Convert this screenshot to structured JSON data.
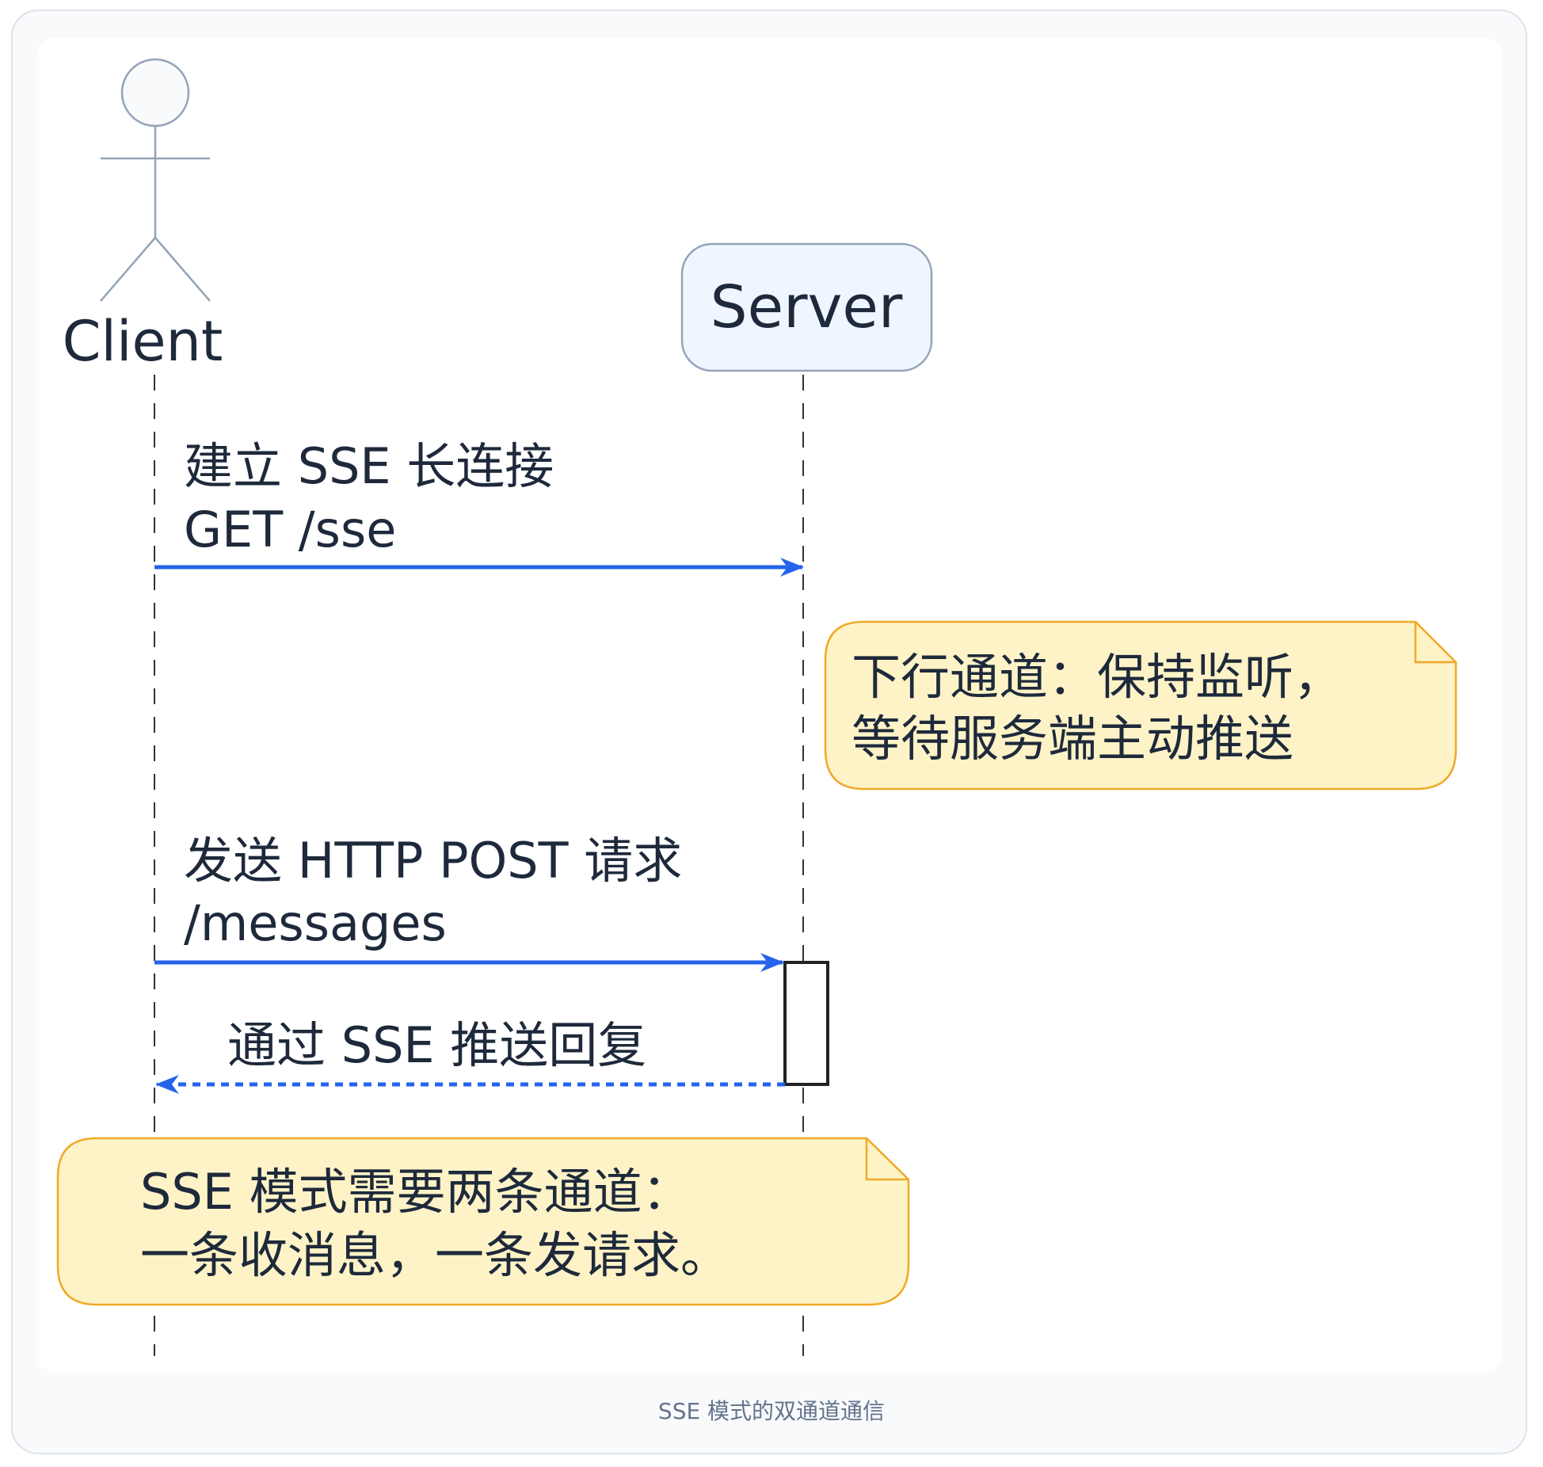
{
  "participants": {
    "client": "Client",
    "server": "Server"
  },
  "messages": [
    {
      "line1": "建立 SSE 长连接",
      "line2": "GET /sse"
    },
    {
      "line1": "发送 HTTP POST 请求",
      "line2": "/messages"
    },
    {
      "line1": "通过 SSE 推送回复"
    }
  ],
  "notes": [
    {
      "line1": "下行通道：保持监听，",
      "line2": "等待服务端主动推送"
    },
    {
      "line1": "SSE 模式需要两条通道：",
      "line2": "一条收消息，一条发请求。"
    }
  ],
  "caption": "SSE 模式的双通道通信",
  "colors": {
    "arrow": "#2563eb",
    "note_fill": "#fef3c7",
    "note_stroke": "#f0a928",
    "server_fill": "#eff6ff",
    "lifeline": "#333333",
    "actor_stroke": "#94a3b8"
  }
}
